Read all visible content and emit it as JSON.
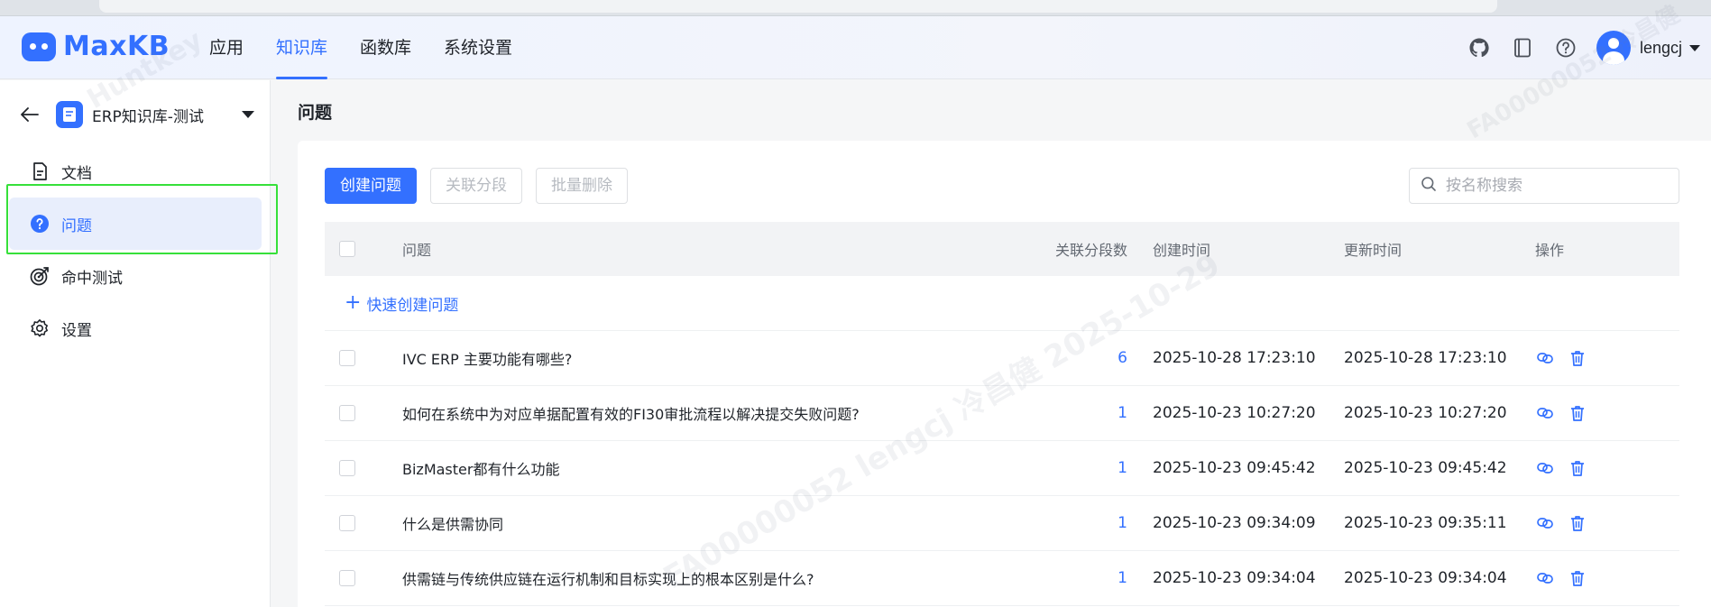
{
  "app": {
    "logo_text": "MaxKB",
    "nav": [
      {
        "label": "应用",
        "active": false
      },
      {
        "label": "知识库",
        "active": true
      },
      {
        "label": "函数库",
        "active": false
      },
      {
        "label": "系统设置",
        "active": false
      }
    ],
    "user": {
      "name": "lengcj"
    },
    "icons": [
      "github-icon",
      "book-icon",
      "help-icon"
    ],
    "accent_color": "#3370ff"
  },
  "sidebar": {
    "knowledge_base_name": "ERP知识库-测试",
    "items": [
      {
        "label": "文档",
        "icon": "document-icon",
        "active": false
      },
      {
        "label": "问题",
        "icon": "question-icon",
        "active": true
      },
      {
        "label": "命中测试",
        "icon": "target-icon",
        "active": false
      },
      {
        "label": "设置",
        "icon": "gear-icon",
        "active": false
      }
    ]
  },
  "main": {
    "title": "问题",
    "toolbar": {
      "create_label": "创建问题",
      "link_label": "关联分段",
      "batch_delete_label": "批量删除"
    },
    "search": {
      "placeholder": "按名称搜索",
      "value": ""
    },
    "table": {
      "columns": {
        "question": "问题",
        "count": "关联分段数",
        "created": "创建时间",
        "updated": "更新时间",
        "ops": "操作"
      },
      "quick_create_label": "快速创建问题",
      "rows": [
        {
          "question": "IVC ERP 主要功能有哪些?",
          "count": "6",
          "created": "2025-10-28 17:23:10",
          "updated": "2025-10-28 17:23:10"
        },
        {
          "question": "如何在系统中为对应单据配置有效的FI30审批流程以解决提交失败问题?",
          "count": "1",
          "created": "2025-10-23 10:27:20",
          "updated": "2025-10-23 10:27:20"
        },
        {
          "question": "BizMaster都有什么功能",
          "count": "1",
          "created": "2025-10-23 09:45:42",
          "updated": "2025-10-23 09:45:42"
        },
        {
          "question": "什么是供需协同",
          "count": "1",
          "created": "2025-10-23 09:34:09",
          "updated": "2025-10-23 09:35:11"
        },
        {
          "question": "供需链与传统供应链在运行机制和目标实现上的根本区别是什么?",
          "count": "1",
          "created": "2025-10-23 09:34:04",
          "updated": "2025-10-23 09:34:04"
        }
      ]
    }
  },
  "watermarks": {
    "a": "FA00000052  lengcj  冷昌健  2025-10-29",
    "b": "Huntkey",
    "c": "FA00000052  冷昌健"
  }
}
